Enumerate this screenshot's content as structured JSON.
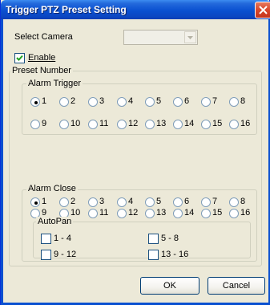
{
  "window": {
    "title": "Trigger PTZ Preset Setting"
  },
  "camera": {
    "label": "Select Camera",
    "selected": ""
  },
  "enable": {
    "label": "Enable",
    "checked": true
  },
  "preset": {
    "group_label": "Preset Number",
    "alarm_trigger": {
      "label": "Alarm Trigger",
      "options": [
        "1",
        "2",
        "3",
        "4",
        "5",
        "6",
        "7",
        "8",
        "9",
        "10",
        "11",
        "12",
        "13",
        "14",
        "15",
        "16"
      ],
      "selected": "1"
    },
    "alarm_close": {
      "label": "Alarm Close",
      "options": [
        "1",
        "2",
        "3",
        "4",
        "5",
        "6",
        "7",
        "8",
        "9",
        "10",
        "11",
        "12",
        "13",
        "14",
        "15",
        "16"
      ],
      "selected": "1"
    },
    "autopan": {
      "label": "AutoPan",
      "options": [
        {
          "label": "1 - 4",
          "checked": false
        },
        {
          "label": "5 - 8",
          "checked": false
        },
        {
          "label": "9 - 12",
          "checked": false
        },
        {
          "label": "13 - 16",
          "checked": false
        }
      ]
    }
  },
  "buttons": {
    "ok": "OK",
    "cancel": "Cancel"
  },
  "colors": {
    "titlebar": "#0a50d0",
    "dialog_bg": "#ece9d8",
    "close_button": "#d9472b"
  }
}
